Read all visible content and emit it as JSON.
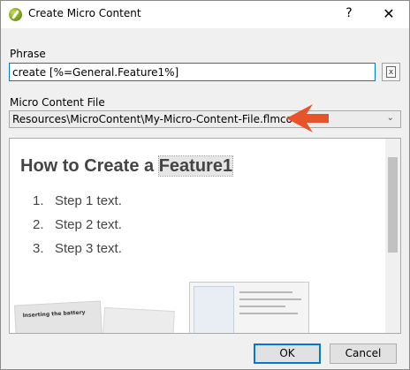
{
  "window": {
    "title": "Create Micro Content",
    "help_label": "?",
    "close_label": "✕",
    "app_icon": "flare-leaf-icon"
  },
  "phrase": {
    "label": "Phrase",
    "value": "create [%=General.Feature1%]"
  },
  "micro_content_file": {
    "label": "Micro Content File",
    "selected": "Resources\\MicroContent\\My-Micro-Content-File.flmco"
  },
  "preview": {
    "title_prefix": "How to Create a ",
    "title_variable": "Feature1",
    "steps": [
      {
        "num": "1.",
        "text": "Step 1 text."
      },
      {
        "num": "2.",
        "text": "Step 2 text."
      },
      {
        "num": "3.",
        "text": "Step 3 text."
      }
    ],
    "thumbnail_left_caption": "Inserting the battery"
  },
  "buttons": {
    "ok": "OK",
    "cancel": "Cancel"
  },
  "colors": {
    "accent_arrow": "#e8542a",
    "focus_border": "#0078d7"
  }
}
